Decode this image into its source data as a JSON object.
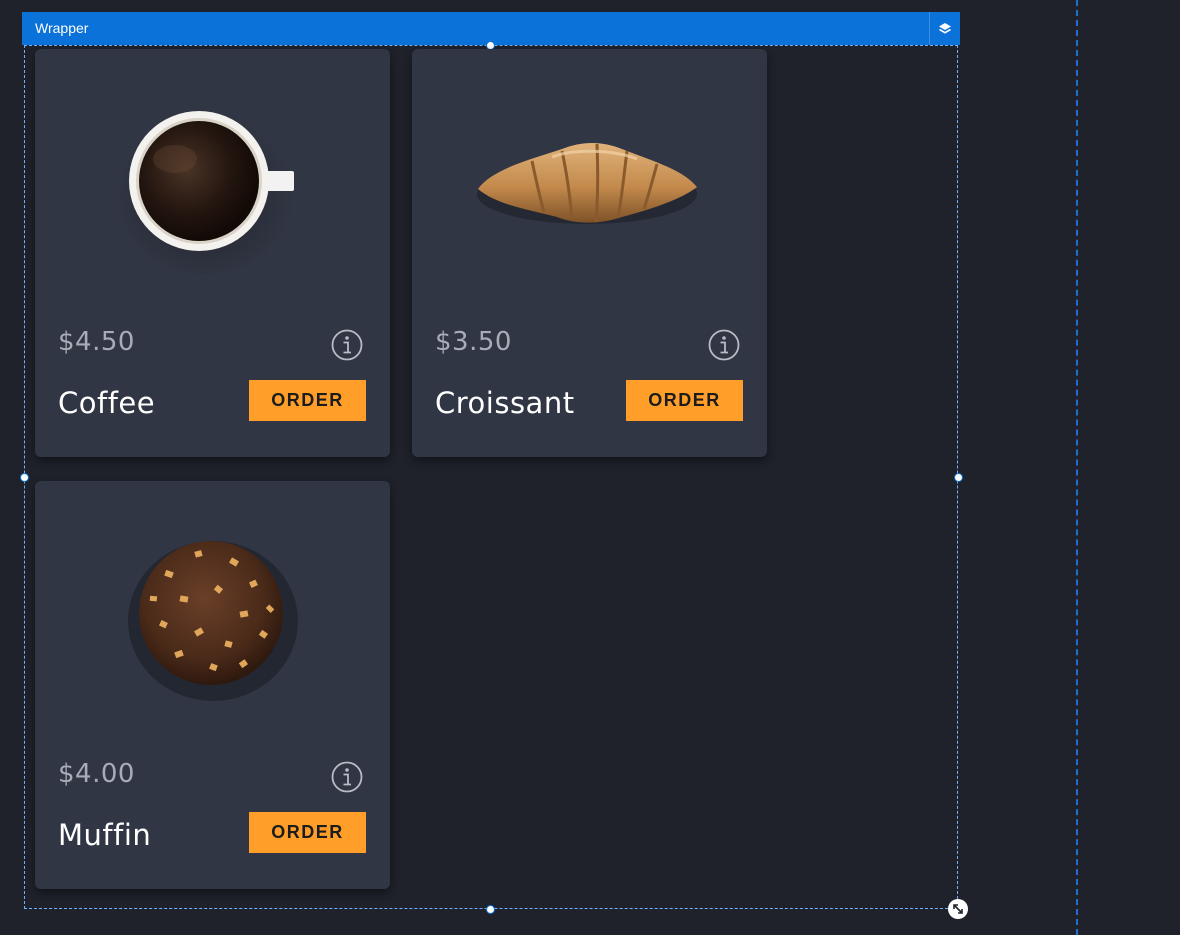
{
  "wrapper": {
    "title": "Wrapper",
    "layers_icon": "layers-icon",
    "resize_icon": "diagonal-resize-icon"
  },
  "products": [
    {
      "name": "Coffee",
      "price": "$4.50",
      "order_label": "ORDER",
      "image": "coffee-cup-image"
    },
    {
      "name": "Croissant",
      "price": "$3.50",
      "order_label": "ORDER",
      "image": "croissant-image"
    },
    {
      "name": "Muffin",
      "price": "$4.00",
      "order_label": "ORDER",
      "image": "muffin-image"
    }
  ],
  "colors": {
    "background": "#1f222b",
    "card": "#313644",
    "accent": "#ff9f2a",
    "selection": "#0a72d8"
  }
}
